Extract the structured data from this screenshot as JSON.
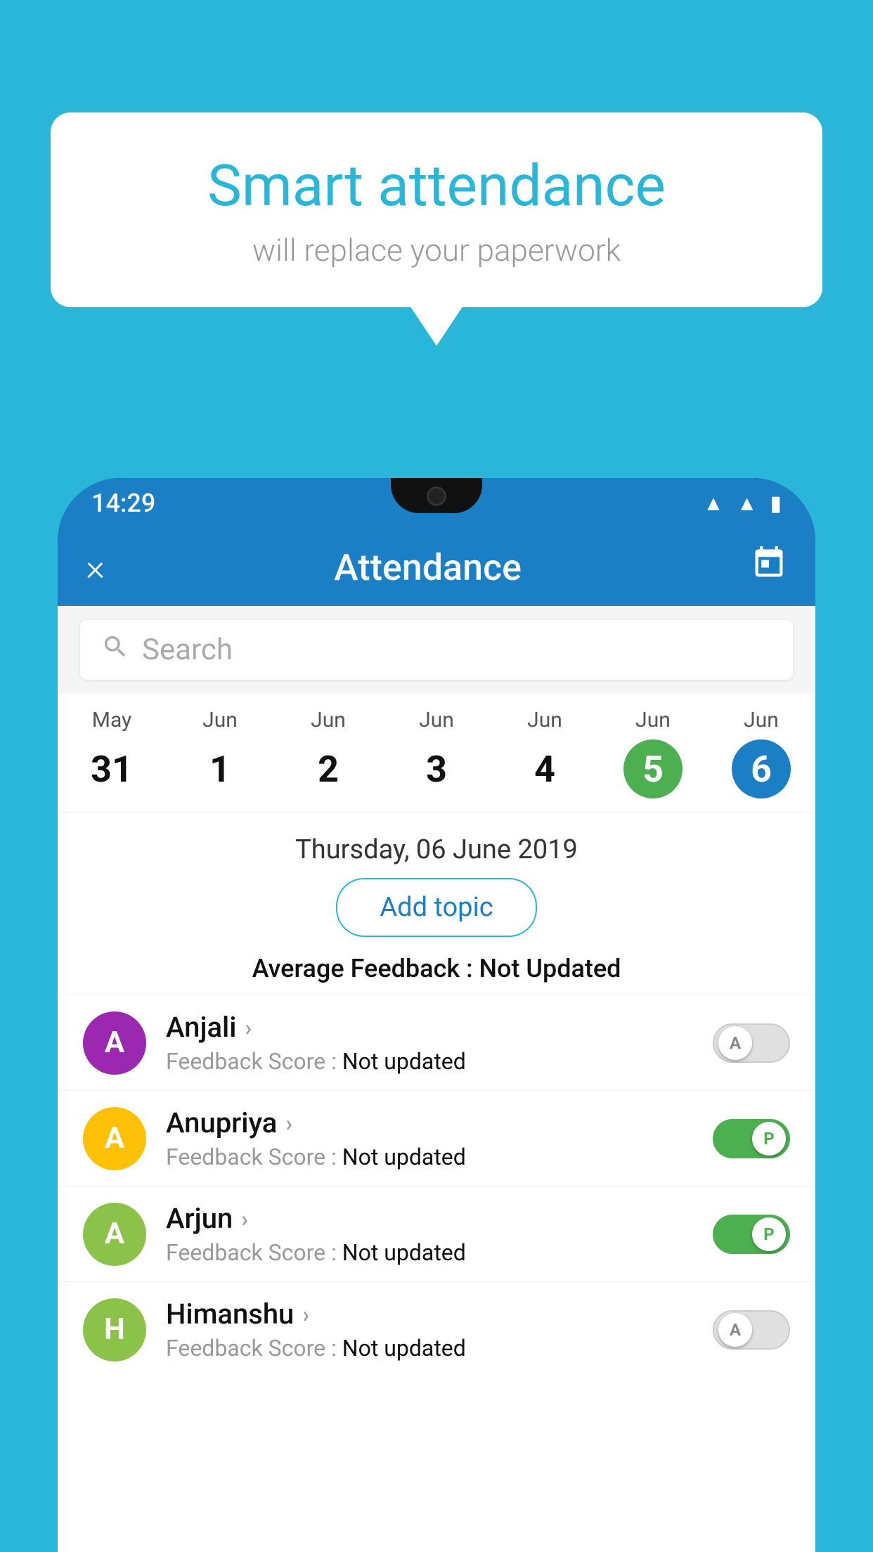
{
  "background_color": "#29b6d8",
  "bubble": {
    "title": "Smart attendance",
    "subtitle": "will replace your paperwork"
  },
  "status_bar": {
    "time": "14:29",
    "icons": [
      "wifi",
      "signal",
      "battery"
    ]
  },
  "app_bar": {
    "title": "Attendance",
    "close_icon": "×",
    "calendar_icon": "📅"
  },
  "search": {
    "placeholder": "Search"
  },
  "calendar": {
    "dates": [
      {
        "month": "May",
        "day": "31",
        "state": "normal"
      },
      {
        "month": "Jun",
        "day": "1",
        "state": "normal"
      },
      {
        "month": "Jun",
        "day": "2",
        "state": "normal"
      },
      {
        "month": "Jun",
        "day": "3",
        "state": "normal"
      },
      {
        "month": "Jun",
        "day": "4",
        "state": "normal"
      },
      {
        "month": "Jun",
        "day": "5",
        "state": "today"
      },
      {
        "month": "Jun",
        "day": "6",
        "state": "selected"
      }
    ]
  },
  "selected_date_label": "Thursday, 06 June 2019",
  "add_topic_label": "Add topic",
  "avg_feedback_label": "Average Feedback :",
  "avg_feedback_value": "Not Updated",
  "students": [
    {
      "name": "Anjali",
      "avatar_letter": "A",
      "avatar_color": "#9c27b0",
      "feedback_label": "Feedback Score :",
      "feedback_value": "Not updated",
      "toggle_state": "off",
      "toggle_label": "A"
    },
    {
      "name": "Anupriya",
      "avatar_letter": "A",
      "avatar_color": "#ffc107",
      "feedback_label": "Feedback Score :",
      "feedback_value": "Not updated",
      "toggle_state": "on",
      "toggle_label": "P"
    },
    {
      "name": "Arjun",
      "avatar_letter": "A",
      "avatar_color": "#8bc34a",
      "feedback_label": "Feedback Score :",
      "feedback_value": "Not updated",
      "toggle_state": "on",
      "toggle_label": "P"
    },
    {
      "name": "Himanshu",
      "avatar_letter": "H",
      "avatar_color": "#8bc34a",
      "feedback_label": "Feedback Score :",
      "feedback_value": "Not updated",
      "toggle_state": "off",
      "toggle_label": "A"
    }
  ]
}
